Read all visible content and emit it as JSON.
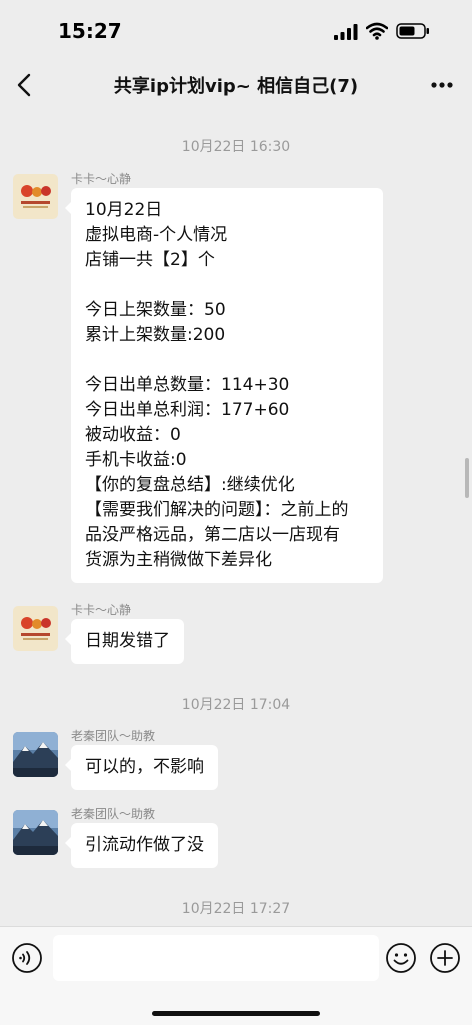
{
  "status_bar": {
    "time": "15:27",
    "icons": [
      "cellular-signal-icon",
      "wifi-icon",
      "battery-icon"
    ]
  },
  "header": {
    "title": "共享ip计划vip~ 相信自己(7)",
    "back_icon": "chevron-left-icon",
    "more_icon": "more-dots-icon"
  },
  "timestamps": [
    "10月22日 16:30",
    "10月22日 17:04",
    "10月22日 17:27"
  ],
  "messages": [
    {
      "sender": "卡卡～心静",
      "avatar": "orange-logo-avatar",
      "lines": [
        "10月22日",
        "虚拟电商-个人情况",
        "店铺一共【2】个",
        "",
        "今日上架数量：50",
        "累计上架数量:200",
        "",
        "今日出单总数量：114+30",
        "今日出单总利润：177+60",
        "被动收益：0",
        "手机卡收益:0",
        "【你的复盘总结】:继续优化",
        "【需要我们解决的问题】：之前上的",
        "品没严格远品，第二店以一店现有",
        "货源为主稍微做下差异化"
      ]
    },
    {
      "sender": "卡卡～心静",
      "avatar": "orange-logo-avatar",
      "text": "日期发错了"
    },
    {
      "sender": "老秦团队～助教",
      "avatar": "mountain-photo-avatar",
      "text": "可以的，不影响"
    },
    {
      "sender": "老秦团队～助教",
      "avatar": "mountain-photo-avatar",
      "text": "引流动作做了没"
    }
  ],
  "input_bar": {
    "text_value": "",
    "icons": [
      "voice-icon",
      "emoji-icon",
      "plus-icon"
    ]
  },
  "colors": {
    "background": "#ededed",
    "bubble": "#ffffff",
    "timestamp": "#9a9a9a"
  }
}
